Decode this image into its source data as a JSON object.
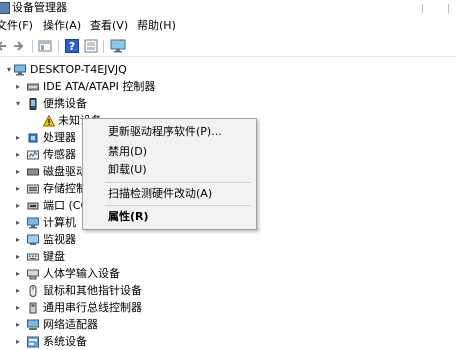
{
  "window": {
    "title": "设备管理器"
  },
  "menu": {
    "file": "文件(F)",
    "action": "操作(A)",
    "view": "查看(V)",
    "help": "帮助(H)"
  },
  "tree": {
    "root": "DESKTOP-T4EJVJQ",
    "items": [
      {
        "label": "IDE ATA/ATAPI 控制器",
        "icon": "ide-controller-icon",
        "expanded": false
      },
      {
        "label": "便携设备",
        "icon": "portable-device-icon",
        "expanded": true
      },
      {
        "label": "未知设备",
        "icon": "warning-device-icon",
        "child": true
      },
      {
        "label": "处理器",
        "icon": "processor-icon",
        "expanded": false
      },
      {
        "label": "传感器",
        "icon": "sensor-icon",
        "expanded": false
      },
      {
        "label": "磁盘驱动",
        "icon": "disk-drive-icon",
        "expanded": false
      },
      {
        "label": "存储控制",
        "icon": "storage-controller-icon",
        "expanded": false
      },
      {
        "label": "端口 (CO",
        "icon": "port-icon",
        "expanded": false
      },
      {
        "label": "计算机",
        "icon": "computer-icon",
        "expanded": false
      },
      {
        "label": "监视器",
        "icon": "monitor-icon",
        "expanded": false
      },
      {
        "label": "键盘",
        "icon": "keyboard-icon",
        "expanded": false
      },
      {
        "label": "人体学输入设备",
        "icon": "hid-icon",
        "expanded": false
      },
      {
        "label": "鼠标和其他指针设备",
        "icon": "mouse-icon",
        "expanded": false
      },
      {
        "label": "通用串行总线控制器",
        "icon": "usb-icon",
        "expanded": false
      },
      {
        "label": "网络适配器",
        "icon": "network-adapter-icon",
        "expanded": false
      },
      {
        "label": "系统设备",
        "icon": "system-device-icon",
        "expanded": false
      }
    ]
  },
  "context_menu": {
    "update_driver": "更新驱动程序软件(P)...",
    "disable": "禁用(D)",
    "uninstall": "卸载(U)",
    "scan": "扫描检测硬件改动(A)",
    "properties": "属性(R)"
  },
  "colors": {
    "accent": "#1f5fbf",
    "warning": "#f2c200",
    "menu_bg": "#f2f2f2"
  }
}
